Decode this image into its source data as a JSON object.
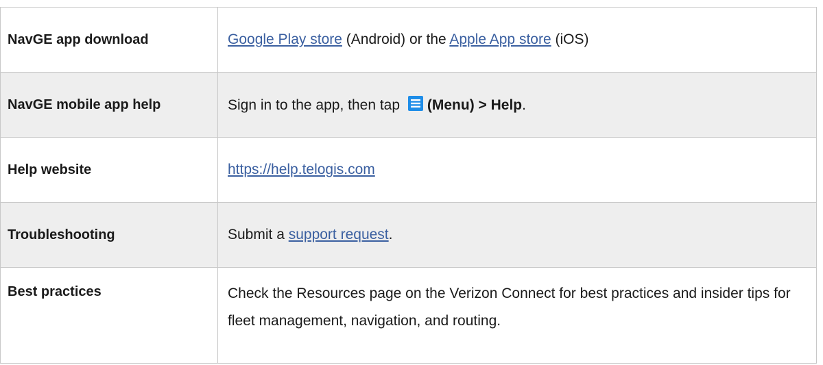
{
  "rows": [
    {
      "label": "NavGE app download",
      "link1": "Google Play store",
      "text1": " (Android) or the ",
      "link2": "Apple App store",
      "text2": " (iOS)"
    },
    {
      "label": "NavGE mobile app help",
      "text1": "Sign in to the app, then tap ",
      "bold1": "(Menu) > Help",
      "text2": ".",
      "icon": "menu-icon"
    },
    {
      "label": "Help website",
      "link1": " https://help.telogis.com"
    },
    {
      "label": "Troubleshooting",
      "text1": "Submit a ",
      "link1": "support request",
      "text2": "."
    },
    {
      "label": "Best practices",
      "text1": "Check the Resources page on the Verizon Connect for best practices and insider tips for fleet management, navigation, and routing."
    }
  ],
  "colors": {
    "link": "#3a5fa0",
    "shaded_row": "#eeeeee",
    "border": "#c8c8c8",
    "icon": "#1e8de8"
  }
}
